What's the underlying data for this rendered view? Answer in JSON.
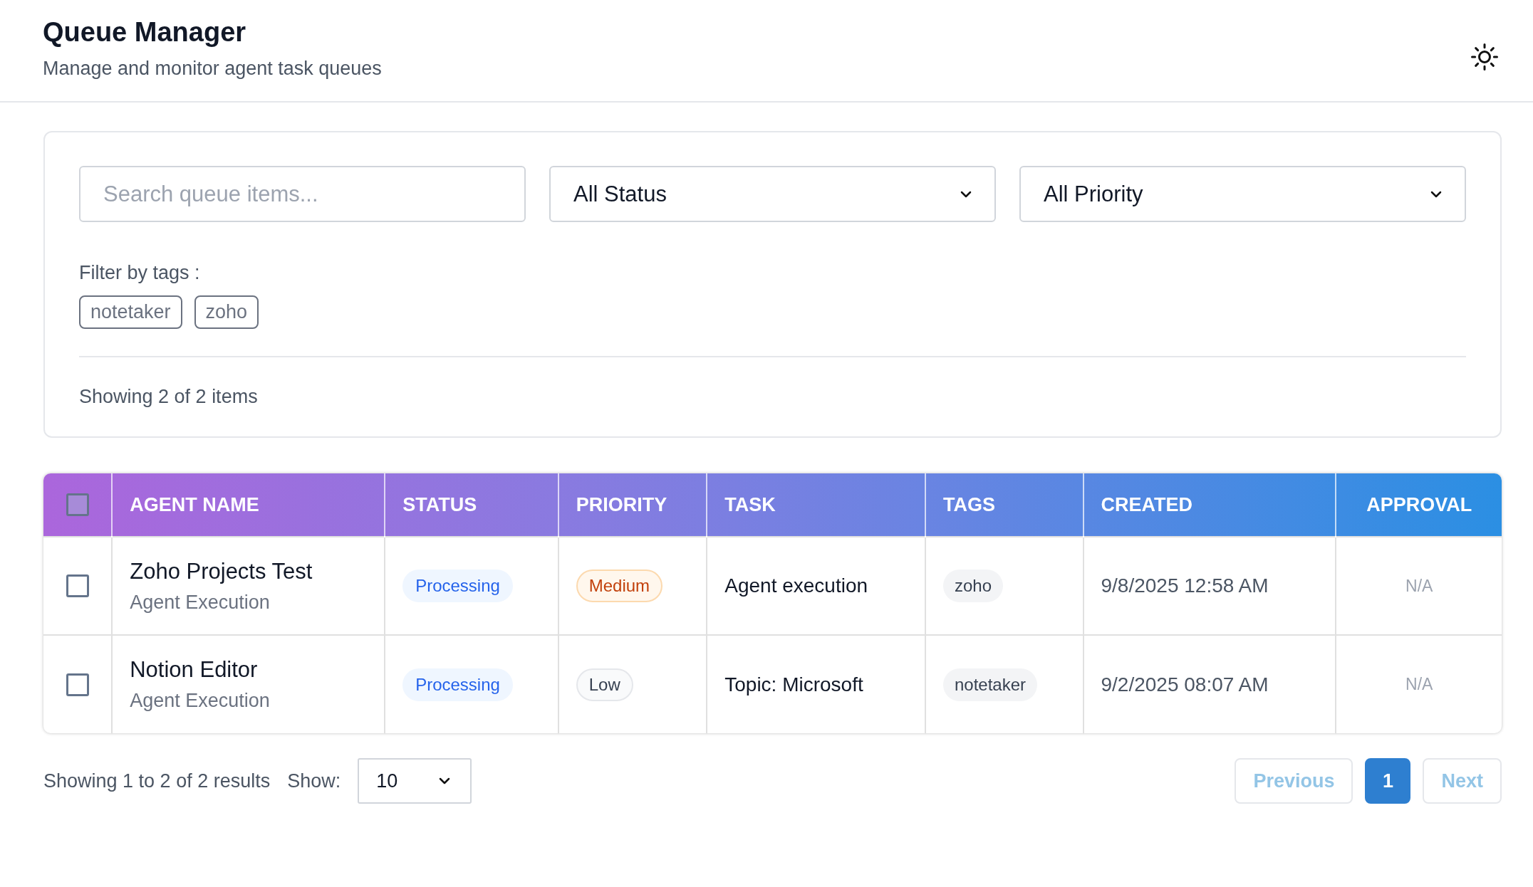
{
  "header": {
    "title": "Queue Manager",
    "subtitle": "Manage and monitor agent task queues"
  },
  "filters": {
    "search": {
      "placeholder": "Search queue items..."
    },
    "status_select": {
      "value": "All Status"
    },
    "priority_select": {
      "value": "All Priority"
    },
    "tags_label": "Filter by tags :",
    "tags": [
      {
        "label": "notetaker",
        "selected": false
      },
      {
        "label": "zoho",
        "selected": false
      }
    ],
    "summary": "Showing 2 of 2 items"
  },
  "table": {
    "select_all": {
      "checked": false
    },
    "columns": [
      "AGENT NAME",
      "STATUS",
      "PRIORITY",
      "TASK",
      "TAGS",
      "CREATED",
      "APPROVAL"
    ],
    "rows": [
      {
        "checked": false,
        "name": "Zoho Projects Test",
        "type": "Agent Execution",
        "status": {
          "label": "Processing",
          "kind": "processing"
        },
        "priority": {
          "label": "Medium",
          "kind": "medium"
        },
        "task": "Agent execution",
        "tags": [
          "zoho"
        ],
        "created": "9/8/2025 12:58 AM",
        "approval": "N/A"
      },
      {
        "checked": false,
        "name": "Notion Editor",
        "type": "Agent Execution",
        "status": {
          "label": "Processing",
          "kind": "processing"
        },
        "priority": {
          "label": "Low",
          "kind": "low"
        },
        "task": "Topic: Microsoft",
        "tags": [
          "notetaker"
        ],
        "created": "9/2/2025 08:07 AM",
        "approval": "N/A"
      }
    ]
  },
  "footer": {
    "results": "Showing 1 to 2 of 2 results",
    "show_label": "Show:",
    "page_size": "10",
    "previous": {
      "label": "Previous",
      "disabled": true
    },
    "pages": [
      {
        "label": "1",
        "selected": true
      }
    ],
    "next": {
      "label": "Next",
      "disabled": true
    }
  }
}
